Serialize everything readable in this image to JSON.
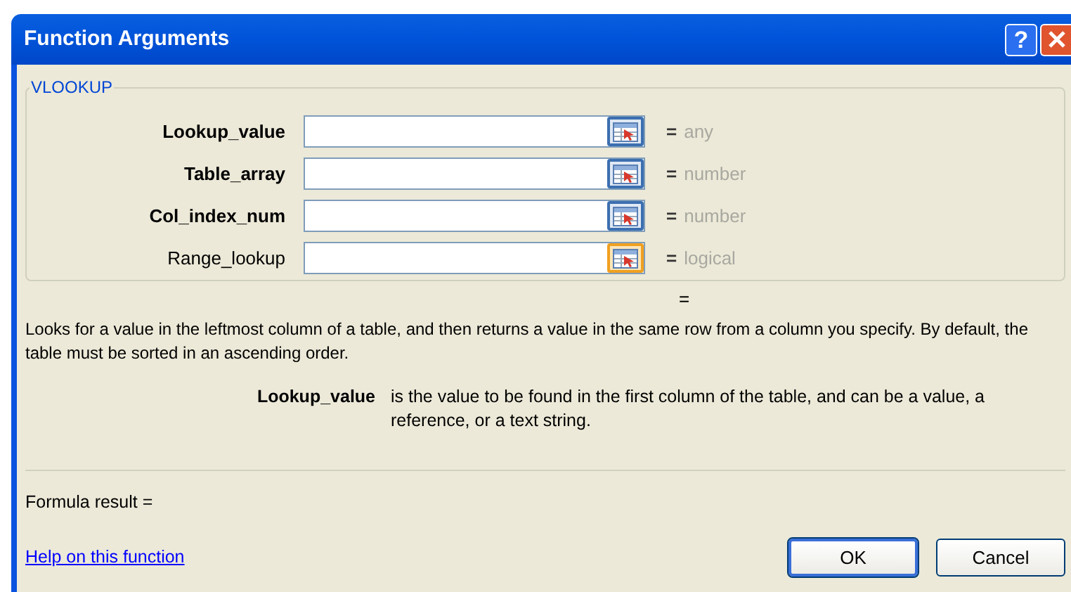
{
  "window": {
    "title": "Function Arguments",
    "help_button": "?"
  },
  "group": {
    "title": "VLOOKUP"
  },
  "arguments": [
    {
      "name": "Lookup_value",
      "required": true,
      "equals": "=",
      "result": "any",
      "picker_highlighted": false
    },
    {
      "name": "Table_array",
      "required": true,
      "equals": "=",
      "result": "number",
      "picker_highlighted": false
    },
    {
      "name": "Col_index_num",
      "required": true,
      "equals": "=",
      "result": "number",
      "picker_highlighted": false
    },
    {
      "name": "Range_lookup",
      "required": false,
      "equals": "=",
      "result": "logical",
      "picker_highlighted": true
    }
  ],
  "result_equals": "=",
  "description": "Looks for a value in the leftmost column of a table, and then returns a value in the same row from a column you specify. By default, the table must be sorted in an ascending order.",
  "argument_help": {
    "name": "Lookup_value",
    "text": "is the value to be found in the first column of the table, and can be a value, a reference, or a text string."
  },
  "formula_result": "Formula result =",
  "help_link": "Help on this function",
  "buttons": [
    {
      "label": "OK",
      "default": true
    },
    {
      "label": "Cancel",
      "default": false
    }
  ]
}
